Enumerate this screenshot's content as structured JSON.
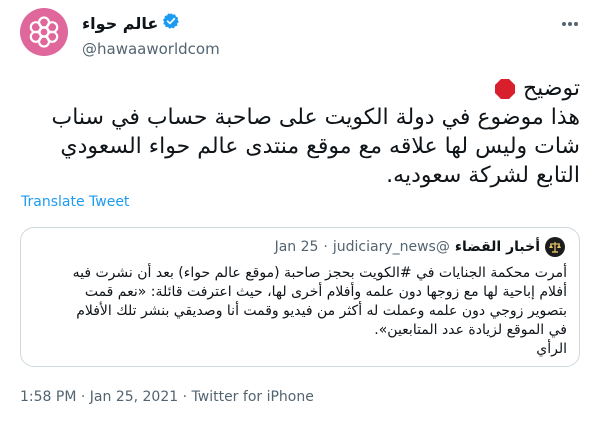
{
  "author": {
    "name": "عالم حواء",
    "handle": "@hawaaworldcom",
    "verified": true
  },
  "tweet": {
    "line1": "توضيح",
    "line2": "هذا موضوع في دولة الكويت على صاحبة حساب في سناب",
    "line3": "شات وليس لها علاقه مع موقع منتدى عالم حواء السعودي",
    "line4": "التابع لشركة سعوديه."
  },
  "translate_label": "Translate Tweet",
  "quote": {
    "name": "أخبار القضاء",
    "handle": "@judiciary_news",
    "separator": "·",
    "date": "Jan 25",
    "line1": "أمرت محكمة الجنايات في #الكويت بحجز صاحبة (موقع عالم حواء) بعد أن نشرت فيه",
    "line2": "أفلام إباحية لها مع زوجها دون علمه وأفلام أخرى لها، حيث اعترفت قائلة: «نعم قمت",
    "line3": "بتصوير زوجي دون علمه وعملت له أكثر من فيديو وقمت أنا وصديقي بنشر تلك الأفلام",
    "line4": "في الموقع لزيادة عدد المتابعين».",
    "line5": "الرأي"
  },
  "meta": {
    "time": "1:58 PM",
    "sep1": " · ",
    "date": "Jan 25, 2021",
    "sep2": " · ",
    "source": "Twitter for iPhone"
  },
  "icons": {
    "verified": "verified-badge-icon",
    "more": "more-options-icon",
    "stop": "stop-sign-icon",
    "quote_avatar": "scales-of-justice-icon"
  },
  "colors": {
    "accent": "#1d9bf0",
    "avatar": "#e0679b",
    "stop": "#d81f2b",
    "muted": "#536471"
  }
}
